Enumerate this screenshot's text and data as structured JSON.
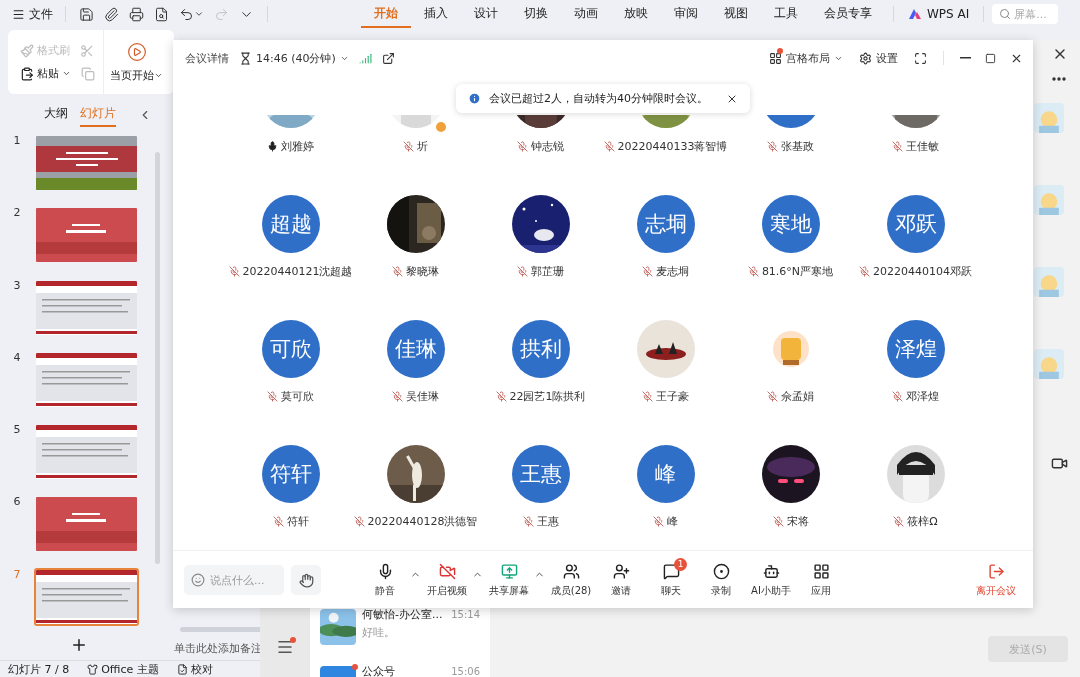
{
  "wps": {
    "menu": {
      "label": "文件"
    },
    "quick_access": [
      {
        "kind": "save",
        "disabled": false,
        "menu": false
      },
      {
        "kind": "clip",
        "disabled": false,
        "menu": false
      },
      {
        "kind": "print",
        "disabled": false,
        "menu": false
      },
      {
        "kind": "preview",
        "disabled": false,
        "menu": false
      },
      {
        "kind": "undo",
        "disabled": false,
        "menu": true
      },
      {
        "kind": "redo",
        "disabled": true,
        "menu": false
      },
      {
        "kind": "more",
        "disabled": false,
        "menu": false
      }
    ],
    "tabs": [
      {
        "label": "开始",
        "selected": true
      },
      {
        "label": "插入",
        "selected": false
      },
      {
        "label": "设计",
        "selected": false
      },
      {
        "label": "切换",
        "selected": false
      },
      {
        "label": "动画",
        "selected": false
      },
      {
        "label": "放映",
        "selected": false
      },
      {
        "label": "审阅",
        "selected": false
      },
      {
        "label": "视图",
        "selected": false
      },
      {
        "label": "工具",
        "selected": false
      },
      {
        "label": "会员专享",
        "selected": false
      }
    ],
    "ai_button": {
      "label": "WPS AI"
    },
    "search": {
      "placeholder": "屏幕..."
    },
    "ribbon": {
      "format_painter": {
        "label": "格式刷",
        "disabled": true
      },
      "cut": {
        "disabled": true
      },
      "paste": {
        "label": "粘贴"
      },
      "copy": {
        "disabled": true
      },
      "slideshow": {
        "label": "当页开始"
      }
    },
    "panel": {
      "tabs": [
        {
          "label": "大纲",
          "selected": false
        },
        {
          "label": "幻灯片",
          "selected": true
        }
      ],
      "slides": [
        {
          "number": "1",
          "kind": "photo-title",
          "selected": false
        },
        {
          "number": "2",
          "kind": "red-title",
          "selected": false
        },
        {
          "number": "3",
          "kind": "text",
          "selected": false
        },
        {
          "number": "4",
          "kind": "text",
          "selected": false
        },
        {
          "number": "5",
          "kind": "text",
          "selected": false
        },
        {
          "number": "6",
          "kind": "red-title",
          "selected": false
        },
        {
          "number": "7",
          "kind": "text",
          "selected": true
        }
      ]
    },
    "notes": {
      "placeholder": "单击此处添加备注"
    },
    "status_bar": {
      "slide": "幻灯片 7 / 8",
      "theme": "Office 主题",
      "proofing": "校对"
    }
  },
  "meeting": {
    "header": {
      "title": "会议详情",
      "timer": "14:46 (40分钟)",
      "layout": "宫格布局",
      "layout_alert": true,
      "settings": "设置"
    },
    "toast": {
      "text": "会议已超过2人，自动转为40分钟限时会议。"
    },
    "participants": [
      {
        "name": "刘雅婷",
        "muted": false,
        "host": false
      },
      {
        "name": "圻",
        "muted": true,
        "host": true
      },
      {
        "name": "钟志锐",
        "muted": true,
        "host": false
      },
      {
        "name": "20220440133蒋智博",
        "muted": true,
        "host": false
      },
      {
        "name": "张基政",
        "muted": true,
        "host": false,
        "avatar": {
          "kind": "plain"
        }
      },
      {
        "name": "王佳敏",
        "muted": true,
        "host": false
      },
      {
        "name": "20220440121沈超越",
        "muted": true,
        "host": false,
        "avatar": {
          "kind": "initials",
          "text": "超越"
        }
      },
      {
        "name": "黎晓琳",
        "muted": true,
        "host": false
      },
      {
        "name": "郭芷珊",
        "muted": true,
        "host": false
      },
      {
        "name": "麦志垌",
        "muted": true,
        "host": false,
        "avatar": {
          "kind": "initials",
          "text": "志垌"
        }
      },
      {
        "name": "81.6°N严寒地",
        "muted": true,
        "host": false,
        "avatar": {
          "kind": "initials",
          "text": "寒地"
        }
      },
      {
        "name": "20220440104邓跃",
        "muted": true,
        "host": false,
        "avatar": {
          "kind": "initials",
          "text": "邓跃"
        }
      },
      {
        "name": "莫可欣",
        "muted": true,
        "host": false,
        "avatar": {
          "kind": "initials",
          "text": "可欣"
        }
      },
      {
        "name": "吴佳琳",
        "muted": true,
        "host": false,
        "avatar": {
          "kind": "initials",
          "text": "佳琳"
        }
      },
      {
        "name": "22园艺1陈拱利",
        "muted": true,
        "host": false,
        "avatar": {
          "kind": "initials",
          "text": "拱利"
        }
      },
      {
        "name": "王子豪",
        "muted": true,
        "host": false
      },
      {
        "name": "佘孟娟",
        "muted": true,
        "host": false
      },
      {
        "name": "邓泽煌",
        "muted": true,
        "host": false,
        "avatar": {
          "kind": "initials",
          "text": "泽煌"
        }
      },
      {
        "name": "符轩",
        "muted": true,
        "host": false,
        "avatar": {
          "kind": "initials",
          "text": "符轩"
        }
      },
      {
        "name": "20220440128洪德智",
        "muted": true,
        "host": false
      },
      {
        "name": "王惠",
        "muted": true,
        "host": false,
        "avatar": {
          "kind": "initials",
          "text": "王惠"
        }
      },
      {
        "name": "峰",
        "muted": true,
        "host": false,
        "avatar": {
          "kind": "initials",
          "text": "峰"
        }
      },
      {
        "name": "宋将",
        "muted": true,
        "host": false
      },
      {
        "name": "筱梓Ω",
        "muted": true,
        "host": false
      }
    ],
    "chat_input": {
      "placeholder": "说点什么..."
    },
    "toolbar": [
      {
        "label": "静音",
        "kind": "mic",
        "menu": true
      },
      {
        "label": "开启视频",
        "kind": "camera-off",
        "menu": true
      },
      {
        "label": "共享屏幕",
        "kind": "screen",
        "menu": true
      },
      {
        "label": "成员(28)",
        "kind": "people",
        "menu": false
      },
      {
        "label": "邀请",
        "kind": "invite",
        "menu": false
      },
      {
        "label": "聊天",
        "kind": "chat",
        "menu": false,
        "badge": "1"
      },
      {
        "label": "录制",
        "kind": "record",
        "menu": false
      },
      {
        "label": "AI小助手",
        "kind": "bot",
        "menu": false
      },
      {
        "label": "应用",
        "kind": "apps",
        "menu": false
      }
    ],
    "leave": {
      "label": "离开会议"
    }
  },
  "wechat": {
    "menu_alert": true,
    "conversations": [
      {
        "name": "何敏怡-办公室...",
        "time": "15:14",
        "preview": "好哇。",
        "kind": "picture",
        "unread": false
      },
      {
        "name": "公众号",
        "time": "15:06",
        "kind": "service",
        "unread": true
      }
    ],
    "send": {
      "label": "发送(S)",
      "disabled": true
    }
  }
}
